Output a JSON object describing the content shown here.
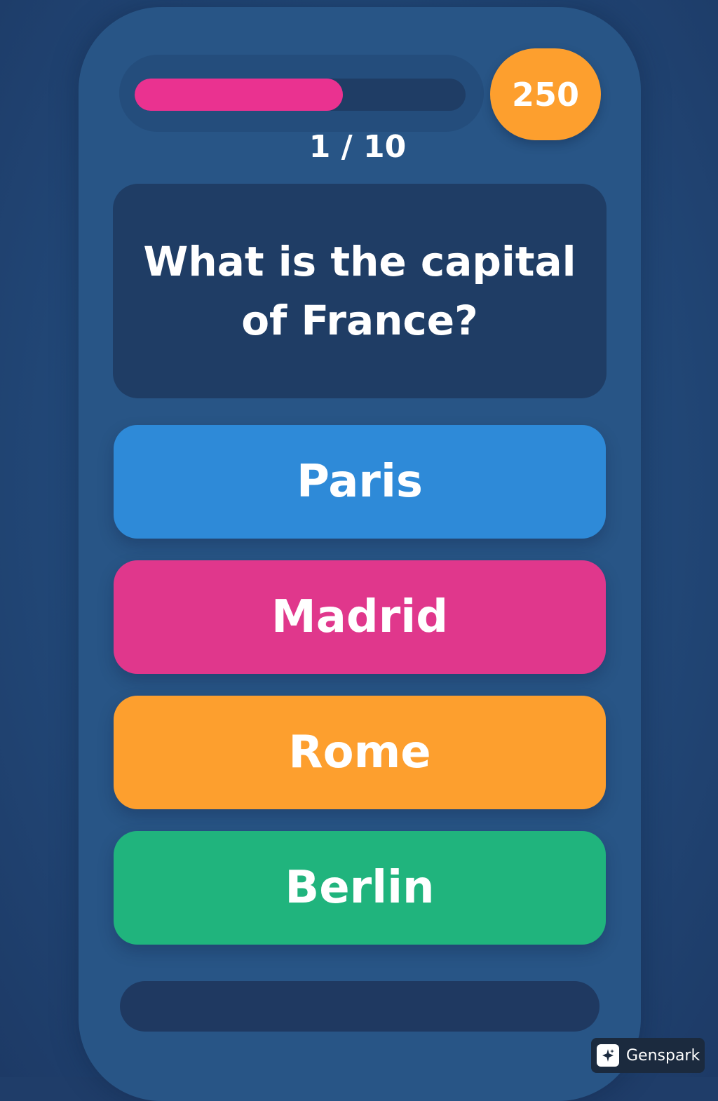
{
  "colors": {
    "progress_fill": "#ea3290",
    "score_badge": "#fd9f2e",
    "answer_colors": [
      "#2e8ad8",
      "#e0378c",
      "#fd9f2e",
      "#20b47d"
    ]
  },
  "progress": {
    "fraction": 0.63
  },
  "score": {
    "value": "250"
  },
  "question": {
    "counter": "1 / 10",
    "text": "What is the capital of France?"
  },
  "answers": [
    {
      "label": "Paris"
    },
    {
      "label": "Madrid"
    },
    {
      "label": "Rome"
    },
    {
      "label": "Berlin"
    }
  ],
  "watermark": {
    "label": "Genspark",
    "icon": "sparkle-icon"
  }
}
